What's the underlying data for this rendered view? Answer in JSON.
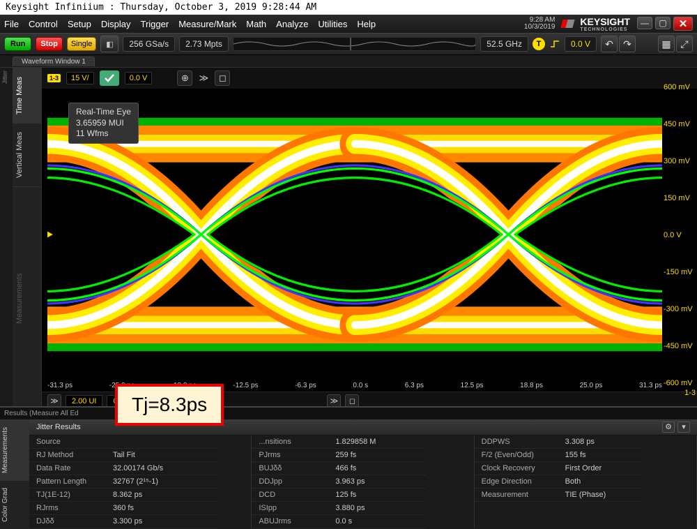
{
  "title_bar": "Keysight Infiniium : Thursday, October 3, 2019 9:28:44 AM",
  "menu": [
    "File",
    "Control",
    "Setup",
    "Display",
    "Trigger",
    "Measure/Mark",
    "Math",
    "Analyze",
    "Utilities",
    "Help"
  ],
  "clock_time": "9:28 AM",
  "clock_date": "10/3/2019",
  "brand": "KEYSIGHT",
  "brand_sub": "TECHNOLOGIES",
  "toolbar": {
    "run": "Run",
    "stop": "Stop",
    "single": "Single",
    "sample_rate": "256 GSa/s",
    "mem_depth": "2.73 Mpts",
    "bandwidth": "52.5 GHz",
    "trig_level": "0.0 V",
    "trig_badge": "T"
  },
  "waveform_tab": "Waveform Window 1",
  "side_tabs": [
    "Time Meas",
    "Vertical Meas",
    "Measurements"
  ],
  "channel": {
    "badge": "1-3",
    "scale_v": "15    V/",
    "offset": "0.0 V"
  },
  "info_box": {
    "l1": "Real-Time Eye",
    "l2": "3.65959 MUI",
    "l3": "11 Wfms"
  },
  "y_ticks": [
    "600 mV",
    "450 mV",
    "300 mV",
    "150 mV",
    "0.0 V",
    "-150 mV",
    "-300 mV",
    "-450 mV",
    "-600 mV"
  ],
  "x_ticks": [
    "-31.3 ps",
    "-25.0 ps",
    "-18.8 ps",
    "-12.5 ps",
    "-6.3 ps",
    "0.0 s",
    "6.3 ps",
    "12.5 ps",
    "18.8 ps",
    "25.0 ps",
    "31.3 ps"
  ],
  "x_ch_label": "1-3",
  "time_scale": {
    "ui": "2.00 UI",
    "offset": "0.0 UI"
  },
  "annotation": "Tj=8.3ps",
  "results_tab": "Results   (Measure All Ed",
  "jitter_header": "Jitter Results",
  "jitter_table": {
    "col1": [
      {
        "k": "Source",
        "v": ""
      },
      {
        "k": "RJ Method",
        "v": "Tail Fit"
      },
      {
        "k": "Data Rate",
        "v": "32.00174 Gb/s"
      },
      {
        "k": "Pattern Length",
        "v": "32767 (2¹⁵-1)"
      },
      {
        "k": "TJ(1E-12)",
        "v": "8.362 ps"
      },
      {
        "k": "RJrms",
        "v": "360 fs"
      },
      {
        "k": "DJδδ",
        "v": "3.300 ps"
      }
    ],
    "col2": [
      {
        "k": "...nsitions",
        "v": "1.829858 M"
      },
      {
        "k": "PJrms",
        "v": "259 fs"
      },
      {
        "k": "BUJδδ",
        "v": "466 fs"
      },
      {
        "k": "DDJpp",
        "v": "3.963 ps"
      },
      {
        "k": "DCD",
        "v": "125 fs"
      },
      {
        "k": "ISIpp",
        "v": "3.880 ps"
      },
      {
        "k": "ABUJrms",
        "v": "0.0 s"
      }
    ],
    "col3": [
      {
        "k": "DDPWS",
        "v": "3.308 ps"
      },
      {
        "k": "F/2 (Even/Odd)",
        "v": "155 fs"
      },
      {
        "k": "Clock Recovery",
        "v": "First Order"
      },
      {
        "k": "Edge Direction",
        "v": "Both"
      },
      {
        "k": "Measurement",
        "v": "TIE (Phase)"
      }
    ]
  },
  "results_side_tabs": [
    "Measurements",
    "Color Grad"
  ],
  "chart_data": {
    "type": "eye-diagram",
    "title": "Real-Time Eye",
    "x_unit": "ps",
    "y_unit": "mV",
    "x_range": [
      -31.3,
      31.3
    ],
    "y_range": [
      -600,
      600
    ],
    "x_ticks": [
      -31.3,
      -25.0,
      -18.8,
      -12.5,
      -6.3,
      0.0,
      6.3,
      12.5,
      18.8,
      25.0,
      31.3
    ],
    "y_ticks": [
      -600,
      -450,
      -300,
      -150,
      0,
      150,
      300,
      450,
      600
    ],
    "rails_mv": {
      "high": 450,
      "low": -450
    },
    "crossings_ps": [
      -15.6,
      15.6
    ],
    "crossing_level_mv": 0,
    "unit_interval_ps": 31.25,
    "mui": 3.65959,
    "waveforms": 11
  }
}
